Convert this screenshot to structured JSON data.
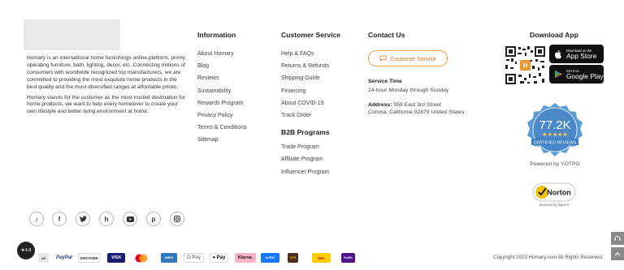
{
  "about": {
    "p1": "Homary is an international home furnishings online platform, primly operating furniture, bath, lighting, decor, etc. Connecting millions of consumers with worldwide recognized top manufacturers, we are committed to providing the most exquisite home products in the best quality and the most diversified ranges at affordable prices.",
    "p2": "Homary stands for the customer as the most trusted destination for home products, we want to help every homelover to create your own lifestyle and better living environment at home."
  },
  "information": {
    "title": "Information",
    "links": [
      "About Homary",
      "Blog",
      "Reviews",
      "Sustainability",
      "Rewards Program",
      "Privacy Policy",
      "Terms & Conditions",
      "Sitemap"
    ]
  },
  "customer_service": {
    "title": "Customer Service",
    "links": [
      "Help & FAQs",
      "Returns & Refunds",
      "Shipping Guide",
      "Financing",
      "About COVID-19",
      "Track Order"
    ]
  },
  "b2b": {
    "title": "B2B Programs",
    "links": [
      "Trade Program",
      "Affiliate Program",
      "Influencer Program"
    ]
  },
  "contact": {
    "title": "Contact Us",
    "button_label": "Customer Service",
    "service_time_label": "Service Time",
    "service_time_value": "24-hour Monday through Sunday",
    "address_label": "Address:",
    "address_line1": "959 East 3rd Street",
    "address_line2": "Corona, California 92879 United States"
  },
  "download": {
    "title": "Download App",
    "app_store_small": "Download on the",
    "app_store_big": "App Store",
    "google_small": "Get it on",
    "google_big": "Google Play"
  },
  "reviews_badge": {
    "count": "77.2K",
    "label": "CERTIFIED REVIEWS",
    "powered": "Powered by YOTPO"
  },
  "norton": {
    "label": "Norton",
    "sub": "powered by digicert"
  },
  "social_icons": [
    "tiktok-icon",
    "facebook-icon",
    "twitter-icon",
    "houzz-icon",
    "youtube-icon",
    "pinterest-icon",
    "instagram-icon"
  ],
  "rating": {
    "value": "4.8"
  },
  "payments": [
    "PayPal",
    "DISCOVER",
    "VISA",
    "Mastercard",
    "AMEX",
    "G Pay",
    "Pay",
    "Klarna.",
    "ALIPAY",
    "UPS",
    "DHL",
    "FedEx"
  ],
  "copyright": "Copyright 2023 Homary.com All Rights Reserved",
  "colors": {
    "accent": "#e8a24a",
    "badge_blue": "#3d7fc4"
  }
}
